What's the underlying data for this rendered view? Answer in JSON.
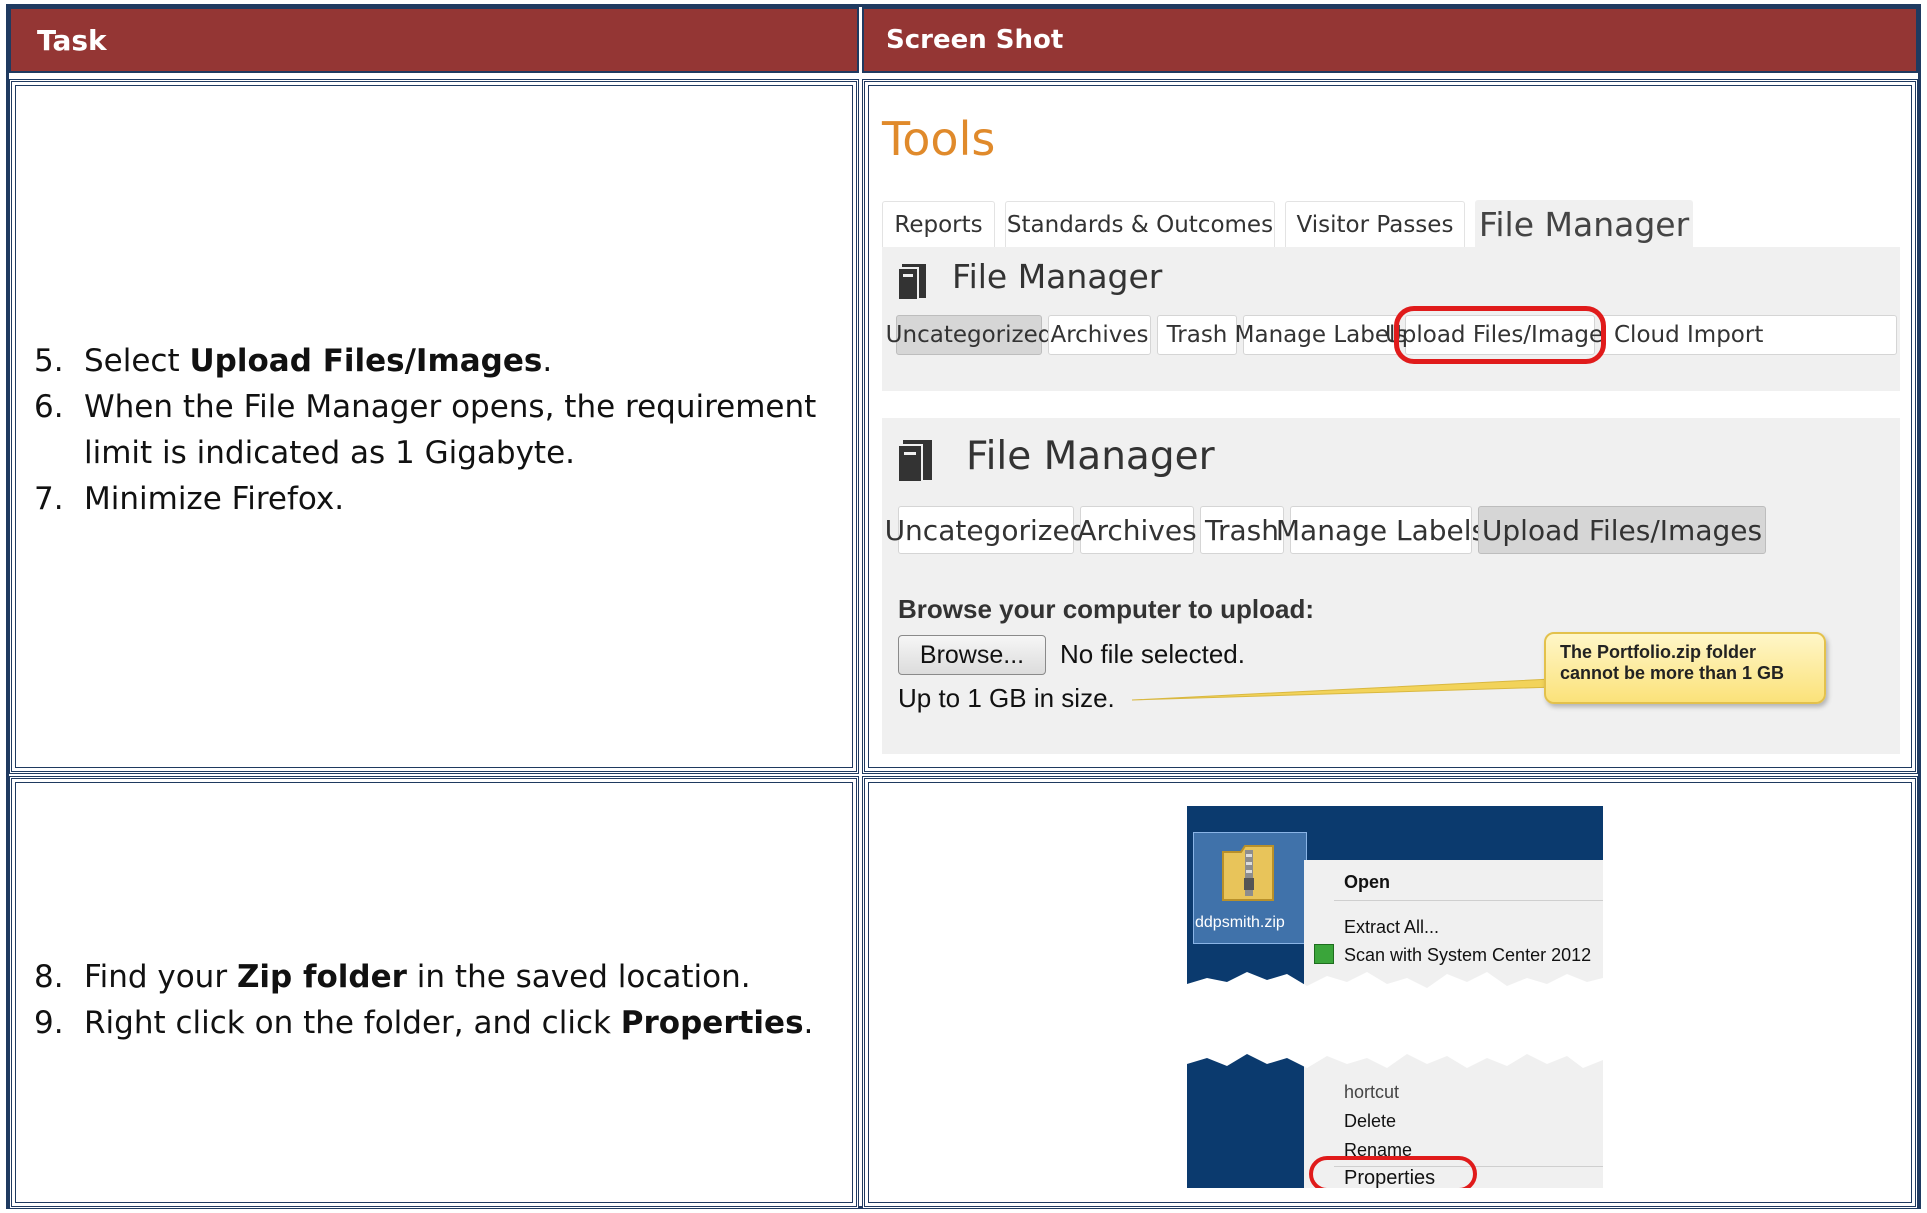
{
  "header": {
    "task": "Task",
    "screenshot": "Screen Shot"
  },
  "row1": {
    "steps": [
      {
        "num": "5.",
        "pre": "Select ",
        "bold": "Upload Files/Images",
        "post": "."
      },
      {
        "num": "6.",
        "pre": "When the File Manager opens, the requirement limit is indicated as 1 Gigabyte.",
        "bold": "",
        "post": ""
      },
      {
        "num": "7.",
        "pre": "Minimize Firefox.",
        "bold": "",
        "post": ""
      }
    ],
    "shot": {
      "title": "Tools",
      "tabs": [
        "Reports",
        "Standards & Outcomes",
        "Visitor Passes",
        "File Manager"
      ],
      "panel1_title": "File Manager",
      "panel1_buttons": [
        "Uncategorized",
        "Archives",
        "Trash",
        "Manage Labels",
        "Upload Files/Images",
        "Cloud Import"
      ],
      "panel2_title": "File Manager",
      "panel2_buttons": [
        "Uncategorized",
        "Archives",
        "Trash",
        "Manage Labels",
        "Upload Files/Images"
      ],
      "browse_heading": "Browse your computer to upload:",
      "browse_button": "Browse...",
      "no_file": "No file selected.",
      "size_note": "Up to 1 GB in size.",
      "callout": "The Portfolio.zip folder cannot be more than 1 GB"
    }
  },
  "row2": {
    "steps": [
      {
        "num": "8.",
        "pre": "Find your ",
        "bold": "Zip folder",
        "post": " in the saved location."
      },
      {
        "num": "9.",
        "pre": "Right click on the folder, and click ",
        "bold": "Properties",
        "post": "."
      }
    ],
    "shot": {
      "file_name": "ddpsmith.zip",
      "menu_items": [
        "Open",
        "Extract All...",
        "Scan with System Center 2012",
        "hortcut",
        "Delete",
        "Rename",
        "Properties"
      ]
    }
  },
  "colors": {
    "header_bg": "#943634",
    "border": "#1f3a60",
    "tools_orange": "#e08a2b",
    "highlight_red": "#e01b1b"
  }
}
